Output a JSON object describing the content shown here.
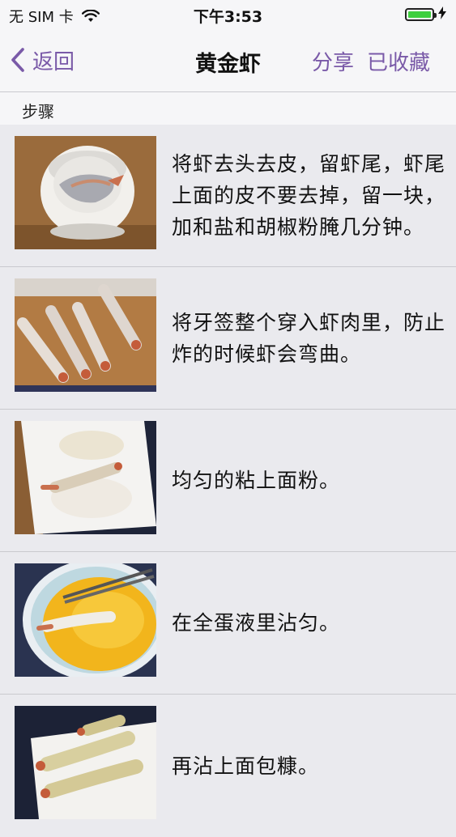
{
  "status_bar": {
    "carrier": "无 SIM 卡",
    "time": "下午3:53",
    "battery_level": 1.0,
    "icons": [
      "wifi-icon",
      "battery-icon",
      "charging-bolt-icon"
    ]
  },
  "nav": {
    "back_label": "返回",
    "title": "黄金虾",
    "share_label": "分享",
    "favorite_label": "已收藏",
    "accent_color": "#7a5aa8"
  },
  "section": {
    "title": "步骤"
  },
  "steps": [
    {
      "text": "将虾去头去皮，留虾尾，虾尾上面的皮不要去掉，留一块，加和盐和胡椒粉腌几分钟。",
      "image": "shrimp-in-bowl"
    },
    {
      "text": "将牙签整个穿入虾肉里，防止炸的时候虾会弯曲。",
      "image": "shrimp-on-board"
    },
    {
      "text": "均匀的粘上面粉。",
      "image": "shrimp-in-flour"
    },
    {
      "text": "在全蛋液里沾匀。",
      "image": "shrimp-in-egg"
    },
    {
      "text": "再沾上面包糠。",
      "image": "shrimp-in-breadcrumbs"
    }
  ]
}
